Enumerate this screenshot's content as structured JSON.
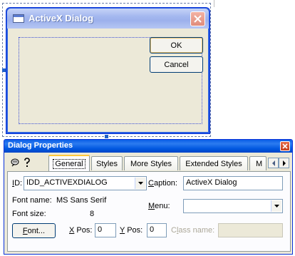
{
  "design_dialog": {
    "title": "ActiveX Dialog",
    "ok_label": "OK",
    "cancel_label": "Cancel"
  },
  "properties": {
    "title": "Dialog Properties",
    "tabs": [
      {
        "label": "General",
        "active": true
      },
      {
        "label": "Styles"
      },
      {
        "label": "More Styles"
      },
      {
        "label": "Extended Styles"
      },
      {
        "label": "M"
      }
    ],
    "id_label": "ID:",
    "id_value": "IDD_ACTIVEXDIALOG",
    "caption_label": "Caption:",
    "caption_value": "ActiveX Dialog",
    "font_name_label": "Font name:",
    "font_name_value": "MS Sans Serif",
    "font_size_label": "Font size:",
    "font_size_value": "8",
    "menu_label": "Menu:",
    "menu_value": "",
    "font_button_label": "Font...",
    "xpos_label": "X Pos:",
    "xpos_value": "0",
    "ypos_label": "Y Pos:",
    "ypos_value": "0",
    "class_name_label": "Class name:",
    "class_name_value": ""
  },
  "colors": {
    "xp_blue": "#0058e0",
    "dialog_face": "#ece9d8",
    "tab_highlight": "#ffc83c"
  }
}
